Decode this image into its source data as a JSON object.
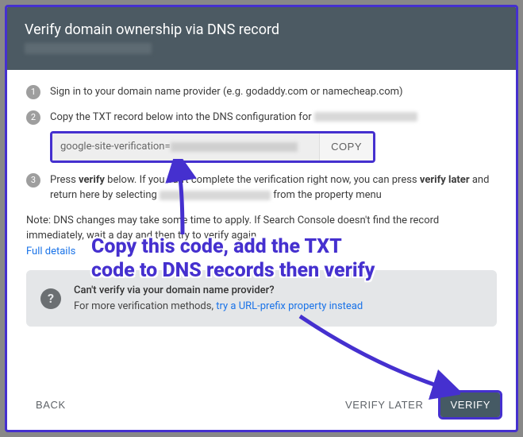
{
  "header": {
    "title": "Verify domain ownership via DNS record"
  },
  "steps": {
    "s1": "Sign in to your domain name provider (e.g. godaddy.com or namecheap.com)",
    "s2_prefix": "Copy the TXT record below into the DNS configuration for ",
    "txt_value": "google-site-verification=",
    "copy_label": "COPY",
    "s3_a": "Press ",
    "s3_b": "verify",
    "s3_c": " below. If you can't complete the verification right now, you can press ",
    "s3_d": "verify later",
    "s3_e": " and return here by selecting ",
    "s3_f": " from the property menu"
  },
  "note": {
    "a": "Note: DNS changes may take some time to apply. If Search Console doesn't find the record immediately, wait a day and then try to verify again",
    "link": "Full details"
  },
  "info": {
    "title": "Can't verify via your domain name provider?",
    "text": "For more verification methods, ",
    "link": "try a URL-prefix property instead"
  },
  "footer": {
    "back": "BACK",
    "later": "VERIFY LATER",
    "verify": "VERIFY"
  },
  "annotation": "Copy this code, add the TXT code to DNS records then verify"
}
